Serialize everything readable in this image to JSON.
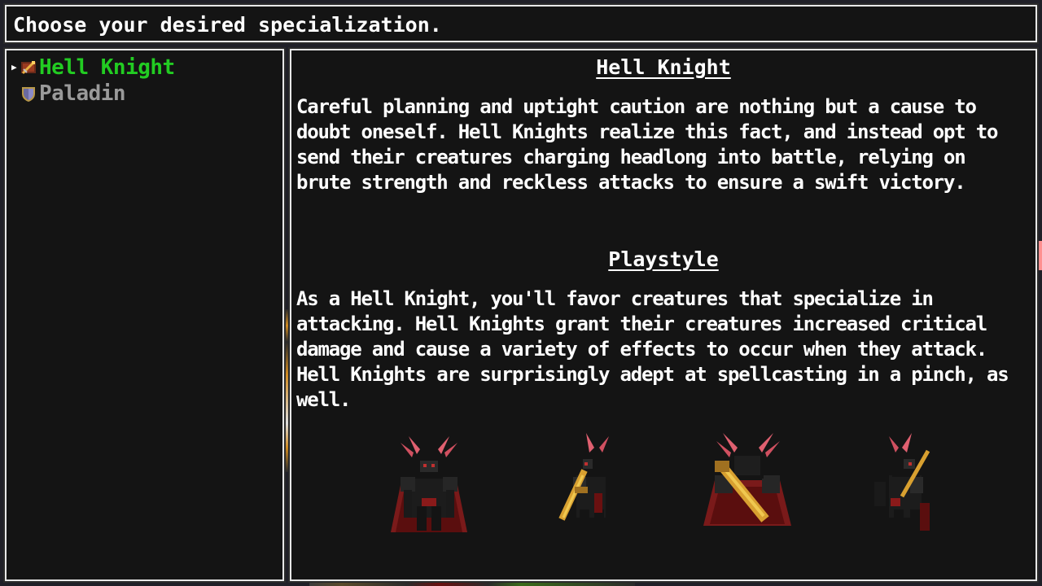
{
  "header": {
    "prompt": "Choose your desired specialization."
  },
  "specializations": [
    {
      "label": "Hell Knight",
      "icon": "hell-knight-sword-icon",
      "selected": true
    },
    {
      "label": "Paladin",
      "icon": "paladin-shield-icon",
      "selected": false
    }
  ],
  "detail": {
    "title": "Hell Knight",
    "description": "Careful planning and uptight caution are nothing but a cause to doubt oneself. Hell Knights realize this fact, and instead opt to send their creatures charging headlong into battle, relying on brute strength and reckless attacks to ensure a swift victory.",
    "playstyle_title": "Playstyle",
    "playstyle_text": "As a Hell Knight, you'll favor creatures that specialize in attacking. Hell Knights grant their creatures increased critical damage and cause a variety of effects to occur when they attack. Hell Knights are surprisingly adept at spellcasting in a pinch, as well."
  },
  "sprites": [
    {
      "name": "hell-knight-sprite-front",
      "icon": "horned-dark-knight-front"
    },
    {
      "name": "hell-knight-sprite-side-left",
      "icon": "horned-dark-knight-side"
    },
    {
      "name": "hell-knight-sprite-back",
      "icon": "horned-dark-knight-back"
    },
    {
      "name": "hell-knight-sprite-side-right",
      "icon": "horned-dark-knight-side"
    }
  ],
  "colors": {
    "selected": "#22cc22",
    "unselected": "#9a9a9a",
    "panel_bg": "#141414",
    "panel_border": "#e8e8e8"
  }
}
